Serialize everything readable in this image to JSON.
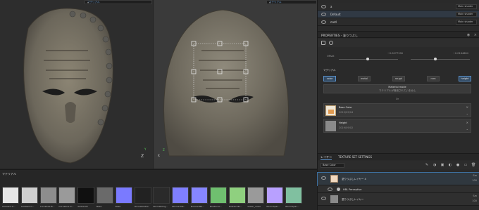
{
  "viewport2d": {
    "dropdown_value": "マテリアル",
    "axis_x": "Z",
    "axis_y": "Y"
  },
  "viewport3d": {
    "dropdown_value": "マテリアル",
    "axis_x": "X",
    "axis_y": "Z"
  },
  "texture_sets": [
    {
      "label": "a",
      "shader": "Main shader"
    },
    {
      "label": "Default",
      "shader": "Main shader",
      "selected": true
    },
    {
      "label": "metl",
      "shader": "Main shader"
    }
  ],
  "properties": {
    "title": "PROPERTIES - 塗りつぶし",
    "offset_label": "Offset",
    "offset_val_1": "−0.0077196",
    "offset_val_2": "−0.0164684",
    "section": "マテリアル",
    "channels": [
      "color",
      "metal",
      "rough",
      "nrm",
      "height"
    ],
    "active_channel": "height",
    "material_mode_title": "Material mode",
    "material_mode_sub": "マテリアルが適用されていません",
    "or": "Or",
    "slots": [
      {
        "name": "Base Color",
        "sub": "2019/09/04",
        "thumb_color": "#d8b080"
      },
      {
        "name": "Height",
        "sub": "2019/09/02",
        "thumb_color": "#8a8a8a"
      }
    ]
  },
  "layers_panel": {
    "tabs": [
      "レイヤー",
      "TEXTURE SET SETTINGS"
    ],
    "blend_dropdown": "Base Color",
    "layers": [
      {
        "name": "塗りつぶしレイヤー 4",
        "blend": "Sm",
        "opacity": "100"
      },
      {
        "name": "HBL Perceptive",
        "blend": "",
        "opacity": ""
      },
      {
        "name": "塗りつぶしレイヤー",
        "blend": "Sm",
        "opacity": "100"
      }
    ]
  },
  "shelf": {
    "title": "マテリアル",
    "items": [
      {
        "label": "Ambient O...",
        "color": "#e6e6e6"
      },
      {
        "label": "Ambient O...",
        "color": "#cfcfcf"
      },
      {
        "label": "Curvature B...",
        "color": "#8d8d8d"
      },
      {
        "label": "Curvature D...",
        "color": "#9a9a9a"
      },
      {
        "label": "Ambient2",
        "color": "#101010"
      },
      {
        "label": "Base",
        "color": "#6a6a6a"
      },
      {
        "label": "Base",
        "color": "#7a7aff"
      },
      {
        "label": "Normalization",
        "color": "#222222"
      },
      {
        "label": "Normalizing...",
        "color": "#2a2a2a"
      },
      {
        "label": "Normal Ma...",
        "color": "#7f7fff"
      },
      {
        "label": "Normal Ma...",
        "color": "#8686ff"
      },
      {
        "label": "Position b...",
        "color": "#6fbf6f"
      },
      {
        "label": "Position Bo...",
        "color": "#8fd07f"
      },
      {
        "label": "sheen_noise",
        "color": "#9a9a9a"
      },
      {
        "label": "World Spac...",
        "color": "#b8a0ff"
      },
      {
        "label": "World Spac...",
        "color": "#80c0a0"
      }
    ]
  }
}
